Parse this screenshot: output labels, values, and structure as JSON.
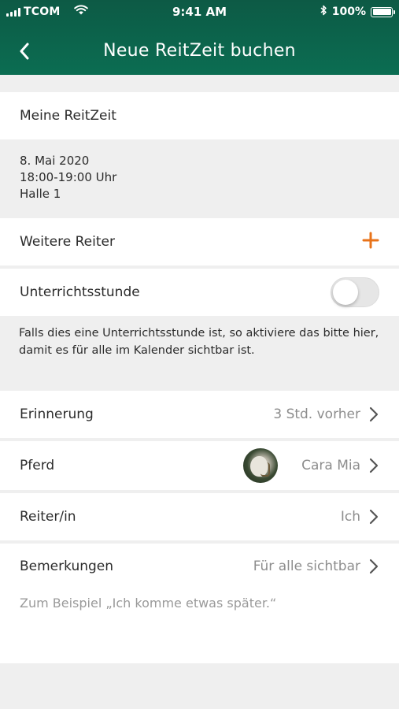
{
  "status_bar": {
    "carrier": "TCOM",
    "time": "9:41 AM",
    "battery": "100%"
  },
  "nav": {
    "title": "Neue ReitZeit buchen",
    "back_icon": "chevron-left-icon"
  },
  "my_reitzeit": {
    "heading": "Meine ReitZeit",
    "date": "8. Mai 2020",
    "time": "18:00-19:00 Uhr",
    "location": "Halle 1"
  },
  "additional_riders": {
    "label": "Weitere Reiter",
    "add_icon": "plus-icon",
    "accent": "#e8731a"
  },
  "lesson": {
    "label": "Unterrichtsstunde",
    "enabled": false,
    "hint": "Falls dies eine Unterrichtsstunde ist, so aktiviere das bitte hier, damit es für alle im Kalender sichtbar ist."
  },
  "reminder": {
    "label": "Erinnerung",
    "value": "3 Std. vorher"
  },
  "horse": {
    "label": "Pferd",
    "value": "Cara Mia"
  },
  "rider": {
    "label": "Reiter/in",
    "value": "Ich"
  },
  "remarks": {
    "label": "Bemerkungen",
    "value": "Für alle sichtbar",
    "placeholder": "Zum Beispiel „Ich komme etwas später.“"
  },
  "colors": {
    "header": "#0b6d52",
    "accent": "#e8731a",
    "background": "#efefef"
  }
}
